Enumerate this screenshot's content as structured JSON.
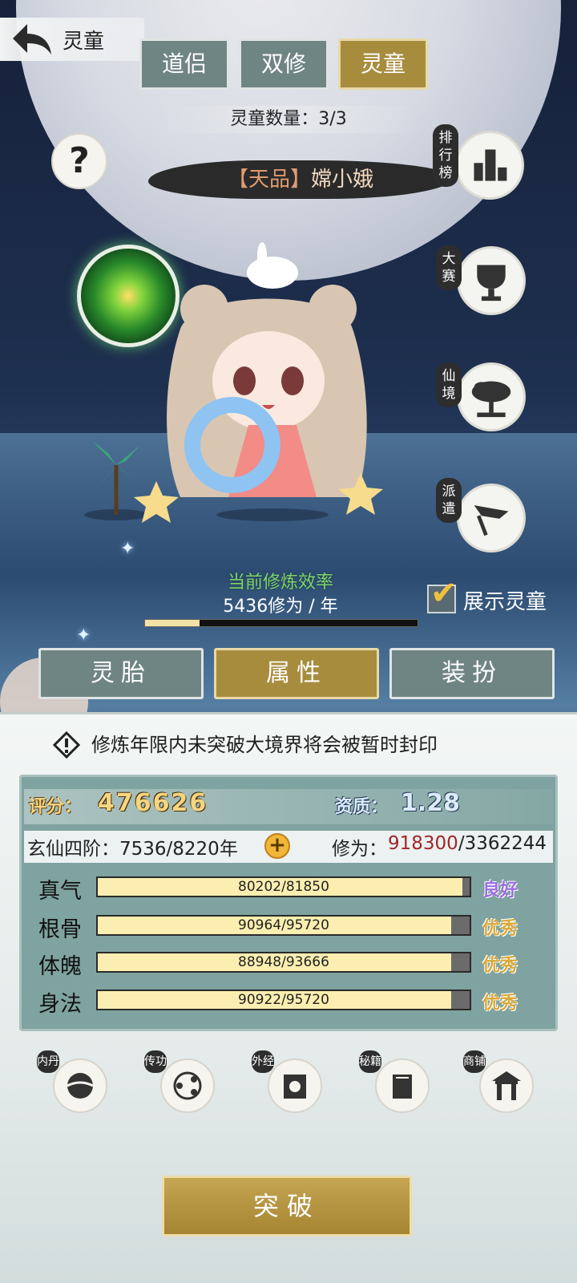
{
  "header": {
    "back_title": "灵童"
  },
  "top_tabs": [
    {
      "label": "道侣",
      "active": false
    },
    {
      "label": "双修",
      "active": false
    },
    {
      "label": "灵童",
      "active": true
    }
  ],
  "spirit_count": "灵童数量：3/3",
  "help_label": "?",
  "spirit_name": {
    "quality": "【天品】",
    "name": "嫦小娥"
  },
  "side_buttons": [
    {
      "label": "排行榜",
      "icon": "ranking-icon"
    },
    {
      "label": "大赛",
      "icon": "trophy-icon"
    },
    {
      "label": "仙境",
      "icon": "tree-icon"
    },
    {
      "label": "派遣",
      "icon": "flag-icon"
    }
  ],
  "cultivation": {
    "title": "当前修炼效率",
    "value": "5436修为 / 年",
    "progress": 0.2
  },
  "show_spirit": {
    "label": "展示灵童",
    "checked": true
  },
  "mid_tabs": [
    {
      "label": "灵胎",
      "active": false
    },
    {
      "label": "属性",
      "active": true
    },
    {
      "label": "装扮",
      "active": false
    }
  ],
  "warning": "修炼年限内未突破大境界将会被暂时封印",
  "stats": {
    "score_label": "评分：",
    "score": "476626",
    "aptitude_label": "资质：",
    "aptitude": "1.28",
    "realm_label": "玄仙四阶：7536/8220年",
    "realm_plus": "+",
    "xiuwei_label": "修为：",
    "xiuwei_current": "918300",
    "xiuwei_total": "/3362244"
  },
  "attributes": [
    {
      "name": "真气",
      "value": "80202/81850",
      "ratio": 0.98,
      "grade": "良好",
      "grade_class": "good"
    },
    {
      "name": "根骨",
      "value": "90964/95720",
      "ratio": 0.95,
      "grade": "优秀",
      "grade_class": "exc"
    },
    {
      "name": "体魄",
      "value": "88948/93666",
      "ratio": 0.95,
      "grade": "优秀",
      "grade_class": "exc"
    },
    {
      "name": "身法",
      "value": "90922/95720",
      "ratio": 0.95,
      "grade": "优秀",
      "grade_class": "exc"
    }
  ],
  "bottom_buttons": [
    {
      "label": "内丹",
      "icon": "inner-pill-icon"
    },
    {
      "label": "传功",
      "icon": "transfer-icon"
    },
    {
      "label": "外经",
      "icon": "scroll-icon"
    },
    {
      "label": "秘籍",
      "icon": "book-icon"
    },
    {
      "label": "商铺",
      "icon": "shop-icon"
    }
  ],
  "breakthrough_label": "突破",
  "colors": {
    "gold": "#a88c3e",
    "slate": "#6f8583",
    "panel": "#7fa3a0"
  }
}
